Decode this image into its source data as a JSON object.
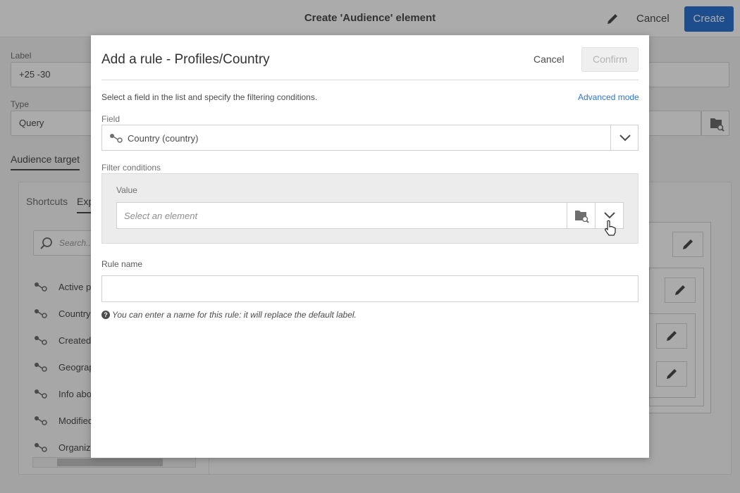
{
  "header": {
    "title": "Create 'Audience' element",
    "cancel_label": "Cancel",
    "create_label": "Create"
  },
  "form": {
    "label_caption": "Label",
    "label_value": "+25 -30",
    "type_caption": "Type",
    "type_value": "Query"
  },
  "audience_tab": "Audience target",
  "explorer": {
    "tabs": [
      "Shortcuts",
      "Exp"
    ],
    "search_placeholder": "Search...",
    "items": [
      "Active pr",
      "Country",
      "Created l",
      "Geograp",
      "Info abou",
      "Modified",
      "Organiza"
    ]
  },
  "dialog": {
    "title": "Add a rule - Profiles/Country",
    "cancel_label": "Cancel",
    "confirm_label": "Confirm",
    "instructions": "Select a field in the list and specify the filtering conditions.",
    "advanced_mode_link": "Advanced mode",
    "field_label": "Field",
    "field_value": "Country (country)",
    "filter_label": "Filter conditions",
    "value_label": "Value",
    "value_placeholder": "Select an element",
    "rule_name_label": "Rule name",
    "rule_name_value": "",
    "hint": "You can enter a name for this rule: it will replace the default label."
  },
  "colors": {
    "accent": "#2d74d2",
    "overlay": "rgba(0,0,0,0.33)"
  },
  "icons": [
    "edit-icon",
    "search-icon",
    "link-icon",
    "chevron-down-icon",
    "folder-search-icon",
    "info-icon",
    "cursor-hand-icon"
  ]
}
